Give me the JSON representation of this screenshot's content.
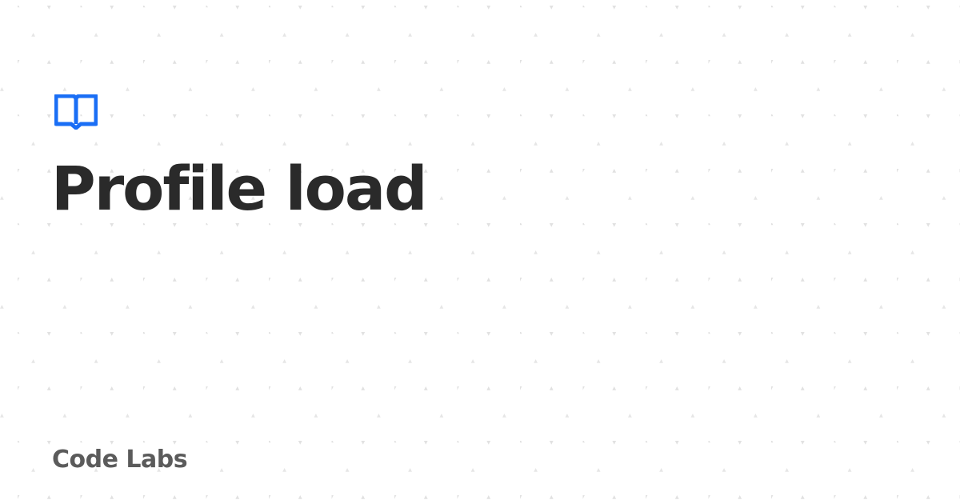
{
  "card": {
    "title": "Profile load",
    "brand": "Code Labs",
    "logo_icon": "book-icon"
  },
  "colors": {
    "background": "#ffffff",
    "accent": "#1a6ef5",
    "title": "#2a2a2a",
    "brand": "#5b5b5b",
    "pattern": "#e1e1e1"
  }
}
